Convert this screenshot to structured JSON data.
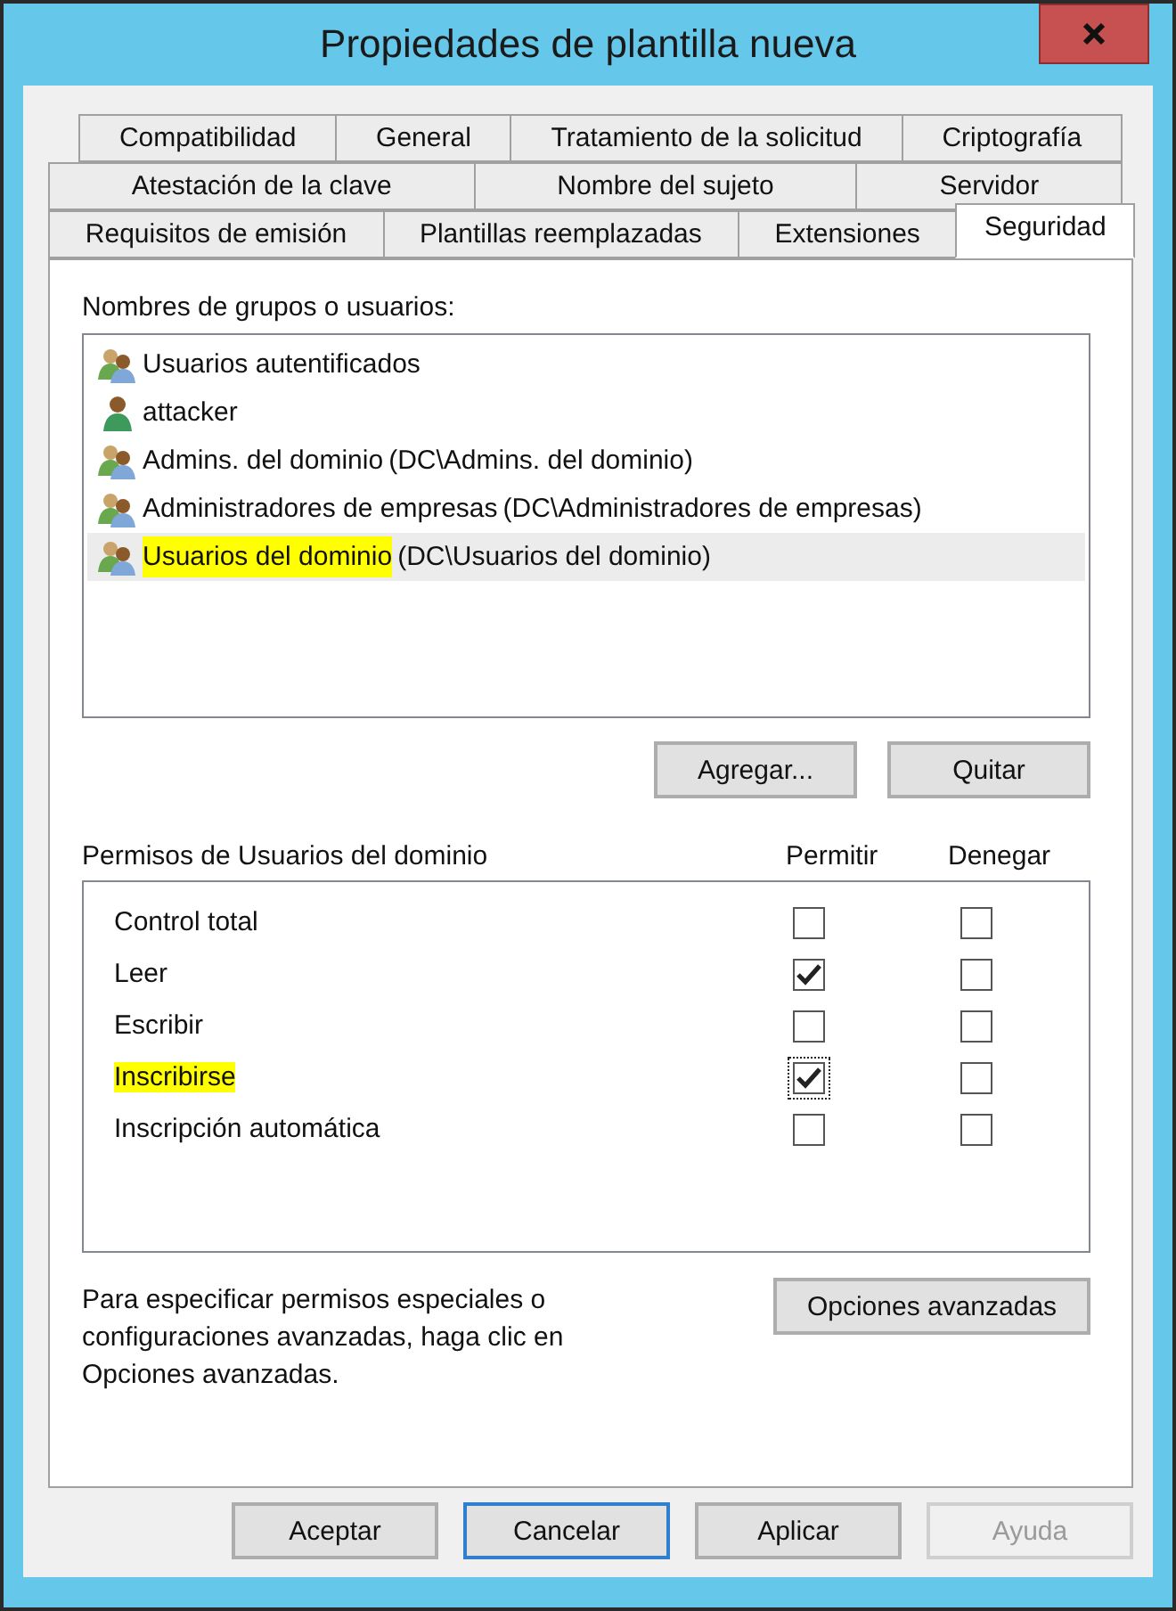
{
  "window": {
    "title": "Propiedades de plantilla nueva"
  },
  "tab_rows": [
    [
      {
        "label": "Compatibilidad",
        "selected": false
      },
      {
        "label": "General",
        "selected": false
      },
      {
        "label": "Tratamiento de la solicitud",
        "selected": false
      },
      {
        "label": "Criptografía",
        "selected": false
      }
    ],
    [
      {
        "label": "Atestación de la clave",
        "selected": false
      },
      {
        "label": "Nombre del sujeto",
        "selected": false
      },
      {
        "label": "Servidor",
        "selected": false
      }
    ],
    [
      {
        "label": "Requisitos de emisión",
        "selected": false
      },
      {
        "label": "Plantillas reemplazadas",
        "selected": false
      },
      {
        "label": "Extensiones",
        "selected": false
      },
      {
        "label": "Seguridad",
        "selected": true
      }
    ]
  ],
  "principals": {
    "label": "Nombres de grupos o usuarios:",
    "items": [
      {
        "kind": "group",
        "name": "Usuarios autentificados",
        "selected": false,
        "highlighted": false
      },
      {
        "kind": "user",
        "name": "attacker",
        "selected": false,
        "highlighted": false
      },
      {
        "kind": "group",
        "name": "Admins. del dominio",
        "path": "(DC\\Admins. del dominio)",
        "selected": false,
        "highlighted": false
      },
      {
        "kind": "group",
        "name": "Administradores de empresas",
        "path": "(DC\\Administradores de empresas)",
        "selected": false,
        "highlighted": false
      },
      {
        "kind": "group",
        "name": "Usuarios del dominio",
        "path": "(DC\\Usuarios del dominio)",
        "selected": true,
        "highlighted": true
      }
    ],
    "buttons": [
      "Agregar...",
      "Quitar"
    ]
  },
  "permissions": {
    "label": "Permisos de Usuarios del dominio",
    "allow_header": "Permitir",
    "deny_header": "Denegar",
    "rows": [
      {
        "name": "Control total",
        "allow": false,
        "deny": false,
        "highlighted": false,
        "focused": false
      },
      {
        "name": "Leer",
        "allow": true,
        "deny": false,
        "highlighted": false,
        "focused": false
      },
      {
        "name": "Escribir",
        "allow": false,
        "deny": false,
        "highlighted": false,
        "focused": false
      },
      {
        "name": "Inscribirse",
        "allow": true,
        "deny": false,
        "highlighted": true,
        "focused": true
      },
      {
        "name": "Inscripción automática",
        "allow": false,
        "deny": false,
        "highlighted": false,
        "focused": false
      }
    ]
  },
  "advanced": {
    "text": "Para especificar permisos especiales o configuraciones avanzadas, haga clic en Opciones avanzadas.",
    "button": "Opciones avanzadas"
  },
  "footer_buttons": [
    {
      "label": "Aceptar",
      "default": false,
      "disabled": false
    },
    {
      "label": "Cancelar",
      "default": true,
      "disabled": false
    },
    {
      "label": "Aplicar",
      "default": false,
      "disabled": false
    },
    {
      "label": "Ayuda",
      "default": false,
      "disabled": true
    }
  ]
}
